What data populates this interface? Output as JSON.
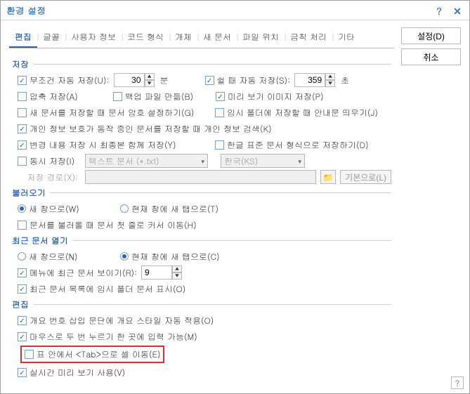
{
  "title": "환경 설정",
  "titlebar": {
    "help": "?",
    "close": "✕"
  },
  "buttons": {
    "apply": "설정(D)",
    "cancel": "취소"
  },
  "tabs": [
    "편집",
    "글꼴",
    "사용자 정보",
    "코드 형식",
    "개체",
    "새 문서",
    "파일 위치",
    "금칙 처리",
    "기타"
  ],
  "groups": {
    "save": "저장",
    "load": "불러오기",
    "recent": "최근 문서 열기",
    "edit": "편집"
  },
  "save": {
    "autosave": "무조건 자동 저장(U):",
    "autosave_val": "30",
    "autosave_unit": "분",
    "idle": "쉴 때 자동 저장(S):",
    "idle_val": "359",
    "idle_unit": "초",
    "compress": "압축 저장(A)",
    "backup": "백업 파일 만듦(B)",
    "preview": "미리 보기 이미지 저장(P)",
    "encrypt": "새 문서를 저장할 때 문서 암호 설정하기(G)",
    "tempmsg": "임시 폴더에 저장할 때 안내문 띄우기(J)",
    "privacy": "개인 정보 보호가 동작 중인 문서를 저장할 때 개인 정보 검색(K)",
    "finalcopy": "변경 내용 저장 시 최종본 함께 저장(Y)",
    "hwpstd": "한글 표준 문서 형식으로 저장하기(D)",
    "dualsave": "동시 저장(I)",
    "dualtype": "텍스트 문서 (*.txt)",
    "duallang": "한국(KS)",
    "savepath": "저장 경로(X):",
    "folder_icon": "folder",
    "default": "기본으로(L)"
  },
  "load": {
    "newwin": "새 창으로(W)",
    "newtab": "현재 창에 새 탭으로(T)",
    "cursortop": "문서를 불러올 때 문서 첫 줄로 커서 이동(H)"
  },
  "recent": {
    "newwin": "새 창으로(N)",
    "newtab": "현재 창에 새 탭으로(C)",
    "menucount": "메뉴에 최근 문서 보이기(R):",
    "menucount_val": "9",
    "showtemp": "최근 문서 목록에 임시 폴더 문서 표시(O)"
  },
  "edit": {
    "outlinestyle": "개요 번호 삽입 문단에 개요 스타일 자동 적용(O)",
    "dblclick": "마우스로 두 번 누르기 한 곳에 입력 가능(M)",
    "tabcell": "표 안에서 <Tab>으로 셀 이동(E)",
    "livepreview": "실시간 미리 보기 사용(V)"
  },
  "footer_help": "?"
}
